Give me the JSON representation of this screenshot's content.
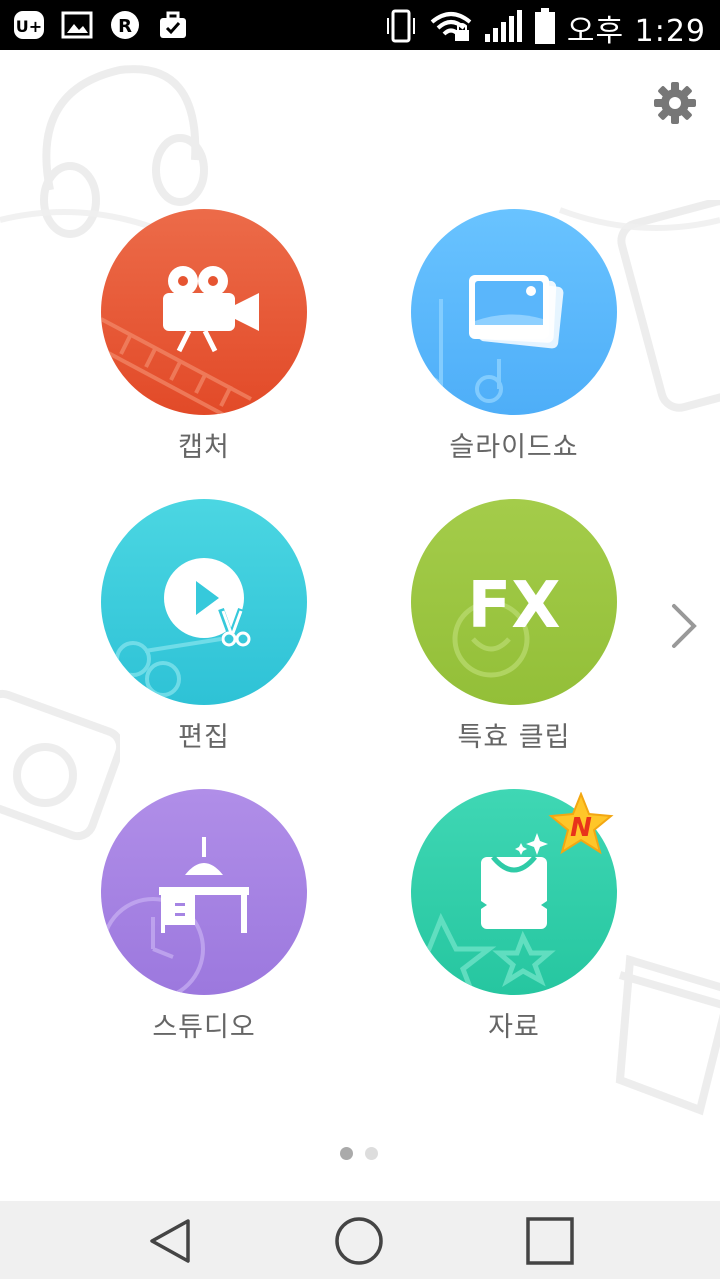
{
  "status_bar": {
    "time": "오후 1:29",
    "icons": [
      "uplus-icon",
      "gallery-icon",
      "r-badge-icon",
      "briefcase-check-icon",
      "vibrate-icon",
      "wifi-lock-icon",
      "signal-icon",
      "battery-icon"
    ]
  },
  "header": {
    "settings_icon": "gear-icon"
  },
  "apps": [
    {
      "label": "캡처",
      "icon": "movie-camera-icon",
      "color": "#e65431"
    },
    {
      "label": "슬라이드쇼",
      "icon": "photo-stack-icon",
      "color": "#5ab6fb"
    },
    {
      "label": "편집",
      "icon": "play-scissors-icon",
      "color": "#36c9db"
    },
    {
      "label": "특효 클립",
      "icon": "fx-icon",
      "color": "#9ac53f",
      "fx_text": "FX"
    },
    {
      "label": "스튜디오",
      "icon": "desk-lamp-icon",
      "color": "#a584e3"
    },
    {
      "label": "자료",
      "icon": "shopping-bag-icon",
      "color": "#2fcba7",
      "badge": "N"
    }
  ],
  "pager": {
    "pages": 2,
    "current": 1,
    "next_icon": "chevron-right-icon"
  },
  "navigation": {
    "buttons": [
      "back-icon",
      "home-icon",
      "recents-icon"
    ]
  }
}
